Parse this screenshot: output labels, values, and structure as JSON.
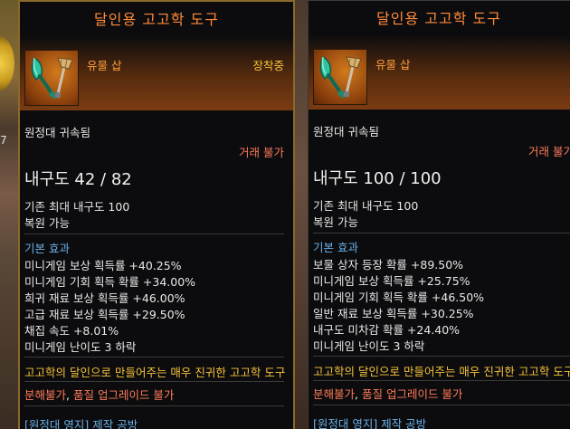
{
  "left_bg_number": "7",
  "tooltips": [
    {
      "title": "달인용 고고학 도구",
      "grade": "유물 삽",
      "equipped": "장착중",
      "bound": "원정대 귀속됨",
      "trade": "거래 불가",
      "durability": "내구도 42 / 82",
      "base_max_durability": "기존 최대 내구도 100",
      "restorable": "복원 가능",
      "basic_effect_header": "기본 효과",
      "effects": [
        "미니게임 보상 획득률 +40.25%",
        "미니게임 기회 획득 확률 +34.00%",
        "희귀 재료 보상 획득률 +46.00%",
        "고급 재료 보상 획득률 +29.50%",
        "채집 속도 +8.01%",
        "미니게임 난이도 3 하락"
      ],
      "description": "고고학의 달인으로 만들어주는 매우 진귀한 고고학 도구",
      "restrictions": [
        "분해불가",
        "품질 업그레이드 불가"
      ],
      "restriction_sep": ", ",
      "footer": "[원정대 영지] 제작 공방"
    },
    {
      "title": "달인용 고고학 도구",
      "grade": "유물 삽",
      "bound": "원정대 귀속됨",
      "trade": "거래 불가",
      "durability": "내구도 100 / 100",
      "base_max_durability": "기존 최대 내구도 100",
      "restorable": "복원 가능",
      "basic_effect_header": "기본 효과",
      "effects": [
        "보물 상자 등장 확률 +89.50%",
        "미니게임 보상 획득률 +25.75%",
        "미니게임 기회 획득 확률 +46.50%",
        "일반 재료 보상 획득률 +30.25%",
        "내구도 미차감 확률 +24.40%",
        "미니게임 난이도 3 하락"
      ],
      "description": "고고학의 달인으로 만들어주는 매우 진귀한 고고학 도구",
      "restrictions": [
        "분해불가",
        "품질 업그레이드 불가"
      ],
      "restriction_sep": ", ",
      "footer": "[원정대 영지] 제작 공방"
    }
  ],
  "colors": {
    "title": "#ff8a3a",
    "grade": "#ff9f3a",
    "equipped": "#f5c23a",
    "trade": "#ff7a5a",
    "section": "#6ab0e8",
    "description": "#f5c23a",
    "restriction": "#ff7a5a",
    "footer": "#6ab0e8",
    "border_equipped": "#8a6a2a"
  },
  "icons": [
    "shovel-icon",
    "brush-icon"
  ]
}
